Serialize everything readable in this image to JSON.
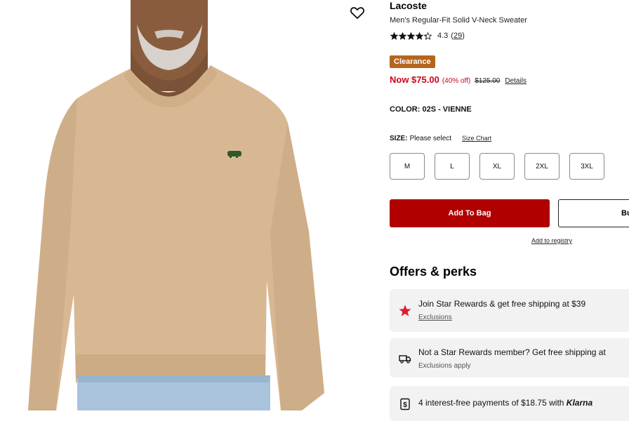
{
  "product": {
    "brand": "Lacoste",
    "name": "Men's Regular-Fit Solid V-Neck Sweater",
    "rating": {
      "value": "4.3",
      "stars_filled": 4.3,
      "stars_total": 5,
      "review_count": "29",
      "open_paren": "(",
      "close_paren": ")"
    },
    "badge": "Clearance",
    "price": {
      "now": "Now $75.00",
      "percent_off": "(40% off)",
      "original": "$125.00",
      "details": "Details"
    },
    "color": {
      "label": "COLOR:",
      "value": "02S - VIENNE"
    },
    "size": {
      "label": "SIZE:",
      "placeholder": "Please select",
      "chart_link": "Size Chart",
      "options": [
        "M",
        "L",
        "XL",
        "2XL",
        "3XL"
      ]
    },
    "actions": {
      "add_to_bag": "Add To Bag",
      "buy_now": "Bu",
      "add_to_registry": "Add to registry"
    }
  },
  "offers": {
    "title": "Offers & perks",
    "items": [
      {
        "icon": "star-icon",
        "main": "Join Star Rewards & get free shipping at $39",
        "sub": "Exclusions"
      },
      {
        "icon": "truck-icon",
        "main": "Not a Star Rewards member? Get free shipping at",
        "sub": "Exclusions apply"
      },
      {
        "icon": "dollar-icon",
        "main_prefix": "4 interest-free payments of $18.75 with ",
        "main_brand": "Klarna"
      }
    ]
  },
  "colors": {
    "accent_red": "#b00000",
    "price_red": "#d0021b",
    "clearance": "#b5651d",
    "star_red": "#e01a2b",
    "sweater": "#d9b996"
  },
  "icons": {
    "wishlist": "heart-icon"
  }
}
